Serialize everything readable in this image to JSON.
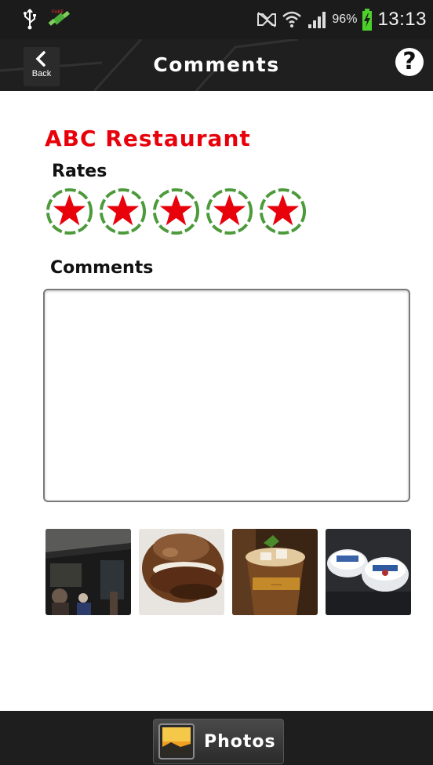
{
  "status_bar": {
    "battery_percent": "96%",
    "time": "13:13",
    "icons": [
      "usb-icon",
      "gps-icon",
      "mute-icon",
      "wifi-icon",
      "signal-icon",
      "battery-charging-icon"
    ]
  },
  "header": {
    "back_label": "Back",
    "title": "Comments",
    "help_label": "?"
  },
  "content": {
    "restaurant_name": "ABC Restaurant",
    "rates_label": "Rates",
    "rating": {
      "value": 5,
      "max": 5
    },
    "comments_label": "Comments",
    "comment_text": ""
  },
  "photos": [
    {
      "name": "photo-street-scene"
    },
    {
      "name": "photo-bagel"
    },
    {
      "name": "photo-drink"
    },
    {
      "name": "photo-containers"
    }
  ],
  "bottom_bar": {
    "photos_label": "Photos"
  },
  "colors": {
    "accent_red": "#e8000b",
    "star_ring_green": "#4c9a3a",
    "bar_dark": "#1b1b1b"
  }
}
